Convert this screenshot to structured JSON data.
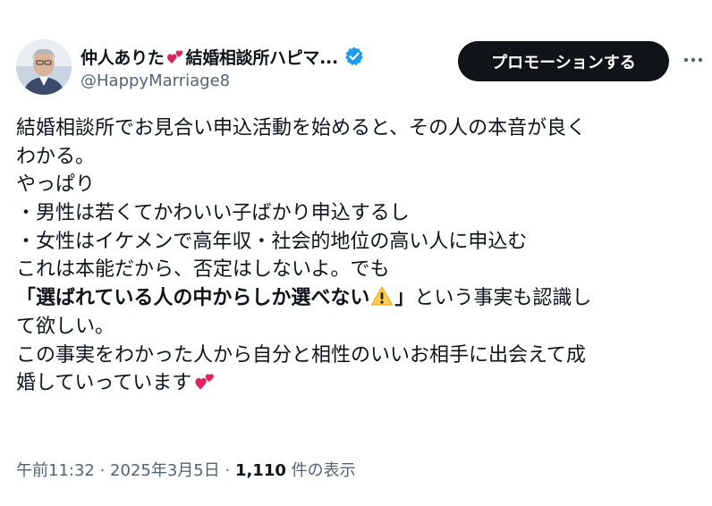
{
  "account": {
    "display_name_part1": "仲人ありた",
    "display_name_part2": "結婚相談所ハピマ...",
    "handle": "@HappyMarriage8",
    "heart_icon": "two-hearts-icon",
    "verified_icon": "verified-badge-icon",
    "verified_color": "#1d9bf0"
  },
  "actions": {
    "promote_label": "プロモーションする",
    "more_icon": "more-dots-icon"
  },
  "tweet": {
    "line1": "結婚相談所でお見合い申込活動を始めると、その人の本音が良く",
    "line2": "わかる。",
    "line3": "やっぱり",
    "line4": "・男性は若くてかわいい子ばかり申込するし",
    "line5": "・女性はイケメンで高年収・社会的地位の高い人に申込む",
    "line6": "これは本能だから、否定はしないよ。でも",
    "line7_bold": "「選ばれている人の中からしか選べない",
    "line7_bold_end": "」",
    "line7_rest": "という事実も認識し",
    "line8": "て欲しい。",
    "line9": "この事実をわかった人から自分と相性のいいお相手に出会えて成",
    "line10": "婚していっています",
    "warning_icon": "warning-icon",
    "end_icon": "two-hearts-icon"
  },
  "meta": {
    "time": "午前11:32",
    "sep1": " · ",
    "date": "2025年3月5日",
    "sep2": " · ",
    "views_count": "1,110",
    "views_label": " 件の表示"
  },
  "colors": {
    "text": "#0f1419",
    "muted": "#536471",
    "button_bg": "#0f1419",
    "heart": "#e0245e"
  }
}
